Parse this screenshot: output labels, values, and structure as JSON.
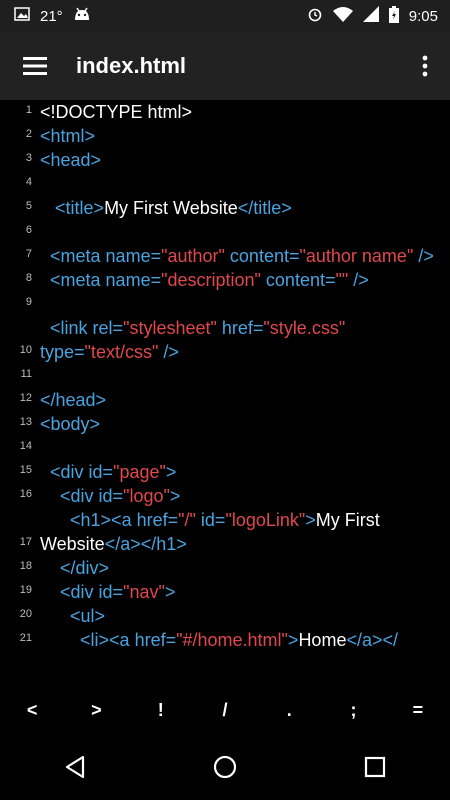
{
  "status_bar": {
    "temperature": "21°",
    "time": "9:05",
    "icons": [
      "image-icon",
      "android-icon",
      "alarm-icon",
      "wifi-icon",
      "signal-icon",
      "battery-icon"
    ]
  },
  "app_bar": {
    "title": "index.html",
    "menu_icon": "hamburger-menu-icon",
    "more_icon": "more-vertical-icon"
  },
  "editor": {
    "lines": [
      {
        "n": "1",
        "segs": [
          [
            "txt",
            "<!DOCTYPE html>"
          ]
        ]
      },
      {
        "n": "2",
        "segs": [
          [
            "tag",
            "<html>"
          ]
        ]
      },
      {
        "n": "3",
        "segs": [
          [
            "tag",
            "<head>"
          ]
        ]
      },
      {
        "n": "4",
        "segs": []
      },
      {
        "n": "5",
        "segs": [
          [
            "txt",
            "   "
          ],
          [
            "tag",
            "<title>"
          ],
          [
            "txt",
            "My First Website"
          ],
          [
            "tag",
            "</title>"
          ]
        ]
      },
      {
        "n": "6",
        "segs": []
      },
      {
        "n": "7",
        "segs": [
          [
            "txt",
            "  "
          ],
          [
            "tag",
            "<meta "
          ],
          [
            "attr",
            "name="
          ],
          [
            "val",
            "\"author\""
          ],
          [
            "attr",
            " content="
          ],
          [
            "val",
            "\"author name\""
          ],
          [
            "tag",
            " />"
          ]
        ]
      },
      {
        "n": "8",
        "segs": [
          [
            "txt",
            "  "
          ],
          [
            "tag",
            "<meta "
          ],
          [
            "attr",
            "name="
          ],
          [
            "val",
            "\"description\""
          ],
          [
            "attr",
            " content="
          ],
          [
            "val",
            "\"\""
          ],
          [
            "tag",
            " />"
          ]
        ]
      },
      {
        "n": "9",
        "segs": []
      },
      {
        "n": "10",
        "segs": [
          [
            "txt",
            "  "
          ],
          [
            "tag",
            "<link "
          ],
          [
            "attr",
            "rel="
          ],
          [
            "val",
            "\"stylesheet\""
          ],
          [
            "attr",
            " href="
          ],
          [
            "val",
            "\"style.css\""
          ],
          [
            "attr",
            " type="
          ],
          [
            "val",
            "\"text/css\""
          ],
          [
            "tag",
            " />"
          ]
        ]
      },
      {
        "n": "11",
        "segs": []
      },
      {
        "n": "12",
        "segs": [
          [
            "tag",
            "</head>"
          ]
        ]
      },
      {
        "n": "13",
        "segs": [
          [
            "tag",
            "<body>"
          ]
        ]
      },
      {
        "n": "14",
        "segs": []
      },
      {
        "n": "15",
        "segs": [
          [
            "txt",
            "  "
          ],
          [
            "tag",
            "<div "
          ],
          [
            "attr",
            "id="
          ],
          [
            "val",
            "\"page\""
          ],
          [
            "tag",
            ">"
          ]
        ]
      },
      {
        "n": "16",
        "segs": [
          [
            "txt",
            "    "
          ],
          [
            "tag",
            "<div "
          ],
          [
            "attr",
            "id="
          ],
          [
            "val",
            "\"logo\""
          ],
          [
            "tag",
            ">"
          ]
        ]
      },
      {
        "n": "17",
        "segs": [
          [
            "txt",
            "      "
          ],
          [
            "tag",
            "<h1><a "
          ],
          [
            "attr",
            "href="
          ],
          [
            "val",
            "\"/\""
          ],
          [
            "attr",
            " id="
          ],
          [
            "val",
            "\"logoLink\""
          ],
          [
            "tag",
            ">"
          ],
          [
            "txt",
            "My First Website"
          ],
          [
            "tag",
            "</a></h1>"
          ]
        ]
      },
      {
        "n": "18",
        "segs": [
          [
            "txt",
            "    "
          ],
          [
            "tag",
            "</div>"
          ]
        ]
      },
      {
        "n": "19",
        "segs": [
          [
            "txt",
            "    "
          ],
          [
            "tag",
            "<div "
          ],
          [
            "attr",
            "id="
          ],
          [
            "val",
            "\"nav\""
          ],
          [
            "tag",
            ">"
          ]
        ]
      },
      {
        "n": "20",
        "segs": [
          [
            "txt",
            "      "
          ],
          [
            "tag",
            "<ul>"
          ]
        ]
      },
      {
        "n": "21",
        "segs": [
          [
            "txt",
            "        "
          ],
          [
            "tag",
            "<li><a "
          ],
          [
            "attr",
            "href="
          ],
          [
            "val",
            "\"#/home.html\""
          ],
          [
            "tag",
            ">"
          ],
          [
            "txt",
            "Home"
          ],
          [
            "tag",
            "</a></"
          ]
        ]
      }
    ]
  },
  "symbol_bar": [
    "<",
    ">",
    "!",
    "/",
    ".",
    ";",
    "="
  ],
  "nav_bar": {
    "back_icon": "back-triangle-icon",
    "home_icon": "home-circle-icon",
    "recents_icon": "recents-square-icon"
  },
  "colors": {
    "tag": "#4aa3e0",
    "attribute": "#4aa3e0",
    "value": "#e0484d",
    "text": "#ffffff",
    "appbar": "#222222",
    "statusbar": "#1f1f1f"
  }
}
